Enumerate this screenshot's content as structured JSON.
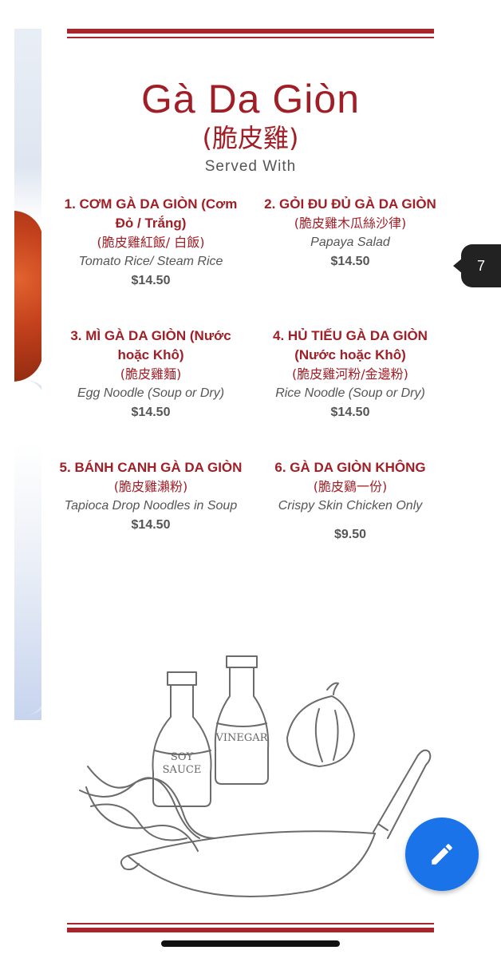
{
  "header": {
    "title": "Gà Da Giòn",
    "subtitle_cn": "(脆皮雞)",
    "served_with": "Served With"
  },
  "items": [
    {
      "name": "1. CƠM GÀ DA GIÒN (Cơm Đỏ / Trắng)",
      "cn": "(脆皮雞紅飯/ 白飯)",
      "en": "Tomato Rice/ Steam Rice",
      "price": "$14.50"
    },
    {
      "name": "2. GỎI ĐU ĐỦ GÀ DA GIÒN",
      "cn": "(脆皮雞木瓜絲沙律)",
      "en": "Papaya Salad",
      "price": "$14.50"
    },
    {
      "name": "3. MÌ GÀ DA GIÒN (Nước hoặc Khô)",
      "cn": "(脆皮雞麵)",
      "en": "Egg Noodle (Soup or Dry)",
      "price": "$14.50"
    },
    {
      "name": "4. HỦ TIẾU GÀ DA GIÒN (Nước hoặc Khô)",
      "cn": "(脆皮雞河粉/金邊粉)",
      "en": "Rice Noodle (Soup or Dry)",
      "price": "$14.50"
    },
    {
      "name": "5. BÁNH CANH GÀ DA GIÒN",
      "cn": "(脆皮雞瀨粉)",
      "en": "Tapioca Drop Noodles in Soup",
      "price": "$14.50"
    },
    {
      "name": "6. GÀ DA GIÒN KHÔNG",
      "cn": "(脆皮鷄一份)",
      "en": "Crispy Skin Chicken Only",
      "price": "$9.50"
    }
  ],
  "illustration": {
    "soy_label_1": "SOY",
    "soy_label_2": "SAUCE",
    "vinegar_label": "VINEGAR"
  },
  "page_tab": {
    "number": "7"
  },
  "fab": {
    "icon": "pencil-icon"
  },
  "colors": {
    "accent": "#a01f27",
    "fab": "#1a73e8",
    "text_gray": "#555555"
  }
}
